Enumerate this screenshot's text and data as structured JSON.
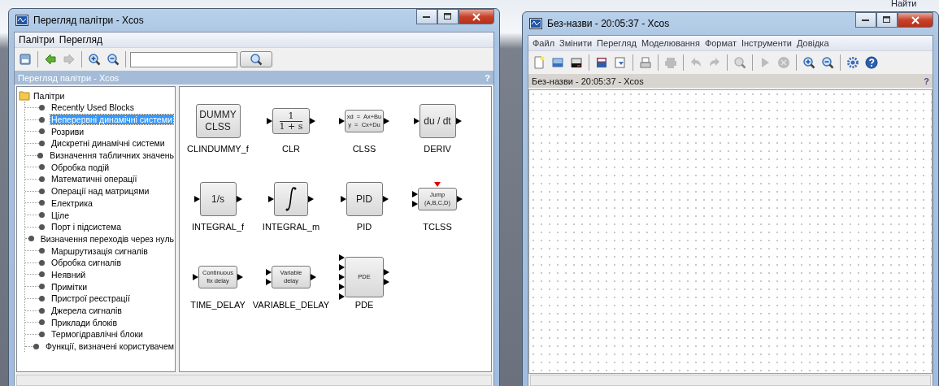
{
  "background": {
    "search_label": "Найти"
  },
  "palette_window": {
    "title": "Перегляд палітри - Xcos",
    "menu": [
      "Палітри",
      "Перегляд"
    ],
    "toolbar": [
      {
        "kind": "palette",
        "disabled": false
      },
      {
        "kind": "sep"
      },
      {
        "kind": "back",
        "disabled": false
      },
      {
        "kind": "forward",
        "disabled": true
      },
      {
        "kind": "sep"
      },
      {
        "kind": "zoom-in",
        "disabled": false
      },
      {
        "kind": "zoom-out",
        "disabled": false
      },
      {
        "kind": "sep"
      }
    ],
    "header": {
      "title": "Перегляд палітри - Xcos",
      "help": "?"
    },
    "tree": {
      "label": "Палітри",
      "expanded": true,
      "children": [
        {
          "label": "Recently Used Blocks",
          "selected": false
        },
        {
          "label": "Неперервні динамічні системи",
          "selected": true
        },
        {
          "label": "Розриви",
          "selected": false
        },
        {
          "label": "Дискретні динамічні системи",
          "selected": false
        },
        {
          "label": "Визначення табличних значень",
          "selected": false
        },
        {
          "label": "Обробка подій",
          "selected": false
        },
        {
          "label": "Математичні операції",
          "selected": false
        },
        {
          "label": "Операції над матрицями",
          "selected": false
        },
        {
          "label": "Електрика",
          "selected": false
        },
        {
          "label": "Ціле",
          "selected": false
        },
        {
          "label": "Порт і підсистема",
          "selected": false
        },
        {
          "label": "Визначення переходів через нуль",
          "selected": false
        },
        {
          "label": "Маршрутизація сигналів",
          "selected": false
        },
        {
          "label": "Обробка сигналів",
          "selected": false
        },
        {
          "label": "Неявний",
          "selected": false
        },
        {
          "label": "Примітки",
          "selected": false
        },
        {
          "label": "Пристрої реєстрації",
          "selected": false
        },
        {
          "label": "Джерела сигналів",
          "selected": false
        },
        {
          "label": "Приклади блоків",
          "selected": false
        },
        {
          "label": "Термогідравлічні блоки",
          "selected": false
        },
        {
          "label": "Функції, визначені користувачем",
          "selected": false
        }
      ]
    },
    "blocks": [
      {
        "name": "CLINDUMMY_f",
        "kind": "text",
        "lines": [
          "DUMMY",
          "CLSS"
        ]
      },
      {
        "name": "CLR",
        "kind": "fraction",
        "lines": [
          "1",
          "1 + s"
        ],
        "ports": [
          {
            "kind": "in"
          },
          {
            "kind": "out"
          }
        ]
      },
      {
        "name": "CLSS",
        "kind": "formula",
        "lines": [
          "xd  =  Ax+Bu",
          "y  =  Cx+Du"
        ],
        "ports": [
          {
            "kind": "in"
          },
          {
            "kind": "out"
          }
        ]
      },
      {
        "name": "DERIV",
        "kind": "text",
        "lines": [
          "du / dt"
        ],
        "ports": [
          {
            "kind": "in"
          },
          {
            "kind": "out"
          }
        ]
      },
      {
        "name": "INTEGRAL_f",
        "kind": "text",
        "lines": [
          "1/s"
        ],
        "ports": [
          {
            "kind": "in"
          },
          {
            "kind": "out"
          }
        ]
      },
      {
        "name": "INTEGRAL_m",
        "kind": "integral",
        "ports": [
          {
            "kind": "in"
          },
          {
            "kind": "out"
          }
        ]
      },
      {
        "name": "PID",
        "kind": "text",
        "lines": [
          "PID"
        ],
        "ports": [
          {
            "kind": "in"
          },
          {
            "kind": "out"
          }
        ]
      },
      {
        "name": "TCLSS",
        "kind": "formula",
        "lines": [
          "Jump",
          "(A,B,C,D)"
        ],
        "ports": [
          {
            "kind": "in"
          },
          {
            "kind": "in"
          },
          {
            "kind": "out"
          },
          {
            "kind": "event"
          }
        ]
      },
      {
        "name": "TIME_DELAY",
        "kind": "formula",
        "lines": [
          "Continuous",
          "fix delay"
        ],
        "ports": [
          {
            "kind": "in"
          },
          {
            "kind": "out"
          }
        ]
      },
      {
        "name": "VARIABLE_DELAY",
        "kind": "formula",
        "lines": [
          "Variable",
          "delay"
        ],
        "ports": [
          {
            "kind": "in"
          },
          {
            "kind": "in"
          },
          {
            "kind": "out"
          }
        ]
      },
      {
        "name": "PDE",
        "kind": "formula",
        "lines": [
          "PDE"
        ],
        "ports": [
          {
            "kind": "in"
          },
          {
            "kind": "in"
          },
          {
            "kind": "in"
          },
          {
            "kind": "in"
          },
          {
            "kind": "in"
          },
          {
            "kind": "out"
          },
          {
            "kind": "out"
          }
        ]
      }
    ]
  },
  "diagram_window": {
    "title": "Без-назви - 20:05:37 - Xcos",
    "menu": [
      "Файл",
      "Змінити",
      "Перегляд",
      "Моделювання",
      "Формат",
      "Інструменти",
      "Довідка"
    ],
    "toolbar": [
      {
        "kind": "new",
        "disabled": false
      },
      {
        "kind": "open",
        "disabled": false
      },
      {
        "kind": "open-dark",
        "disabled": false
      },
      {
        "kind": "sep"
      },
      {
        "kind": "save",
        "disabled": false
      },
      {
        "kind": "save-as",
        "disabled": false
      },
      {
        "kind": "sep"
      },
      {
        "kind": "print",
        "disabled": false
      },
      {
        "kind": "sep"
      },
      {
        "kind": "printer",
        "disabled": true
      },
      {
        "kind": "sep"
      },
      {
        "kind": "undo",
        "disabled": true
      },
      {
        "kind": "redo",
        "disabled": true
      },
      {
        "kind": "sep"
      },
      {
        "kind": "zoom-fit",
        "disabled": true
      },
      {
        "kind": "sep"
      },
      {
        "kind": "play",
        "disabled": true
      },
      {
        "kind": "stop",
        "disabled": true
      },
      {
        "kind": "sep"
      },
      {
        "kind": "zoom-in",
        "disabled": false
      },
      {
        "kind": "zoom-out",
        "disabled": false
      },
      {
        "kind": "sep"
      },
      {
        "kind": "gear",
        "disabled": false
      },
      {
        "kind": "help",
        "disabled": false
      }
    ],
    "header": {
      "title": "Без-назви - 20:05:37 - Xcos",
      "help": "?"
    }
  }
}
